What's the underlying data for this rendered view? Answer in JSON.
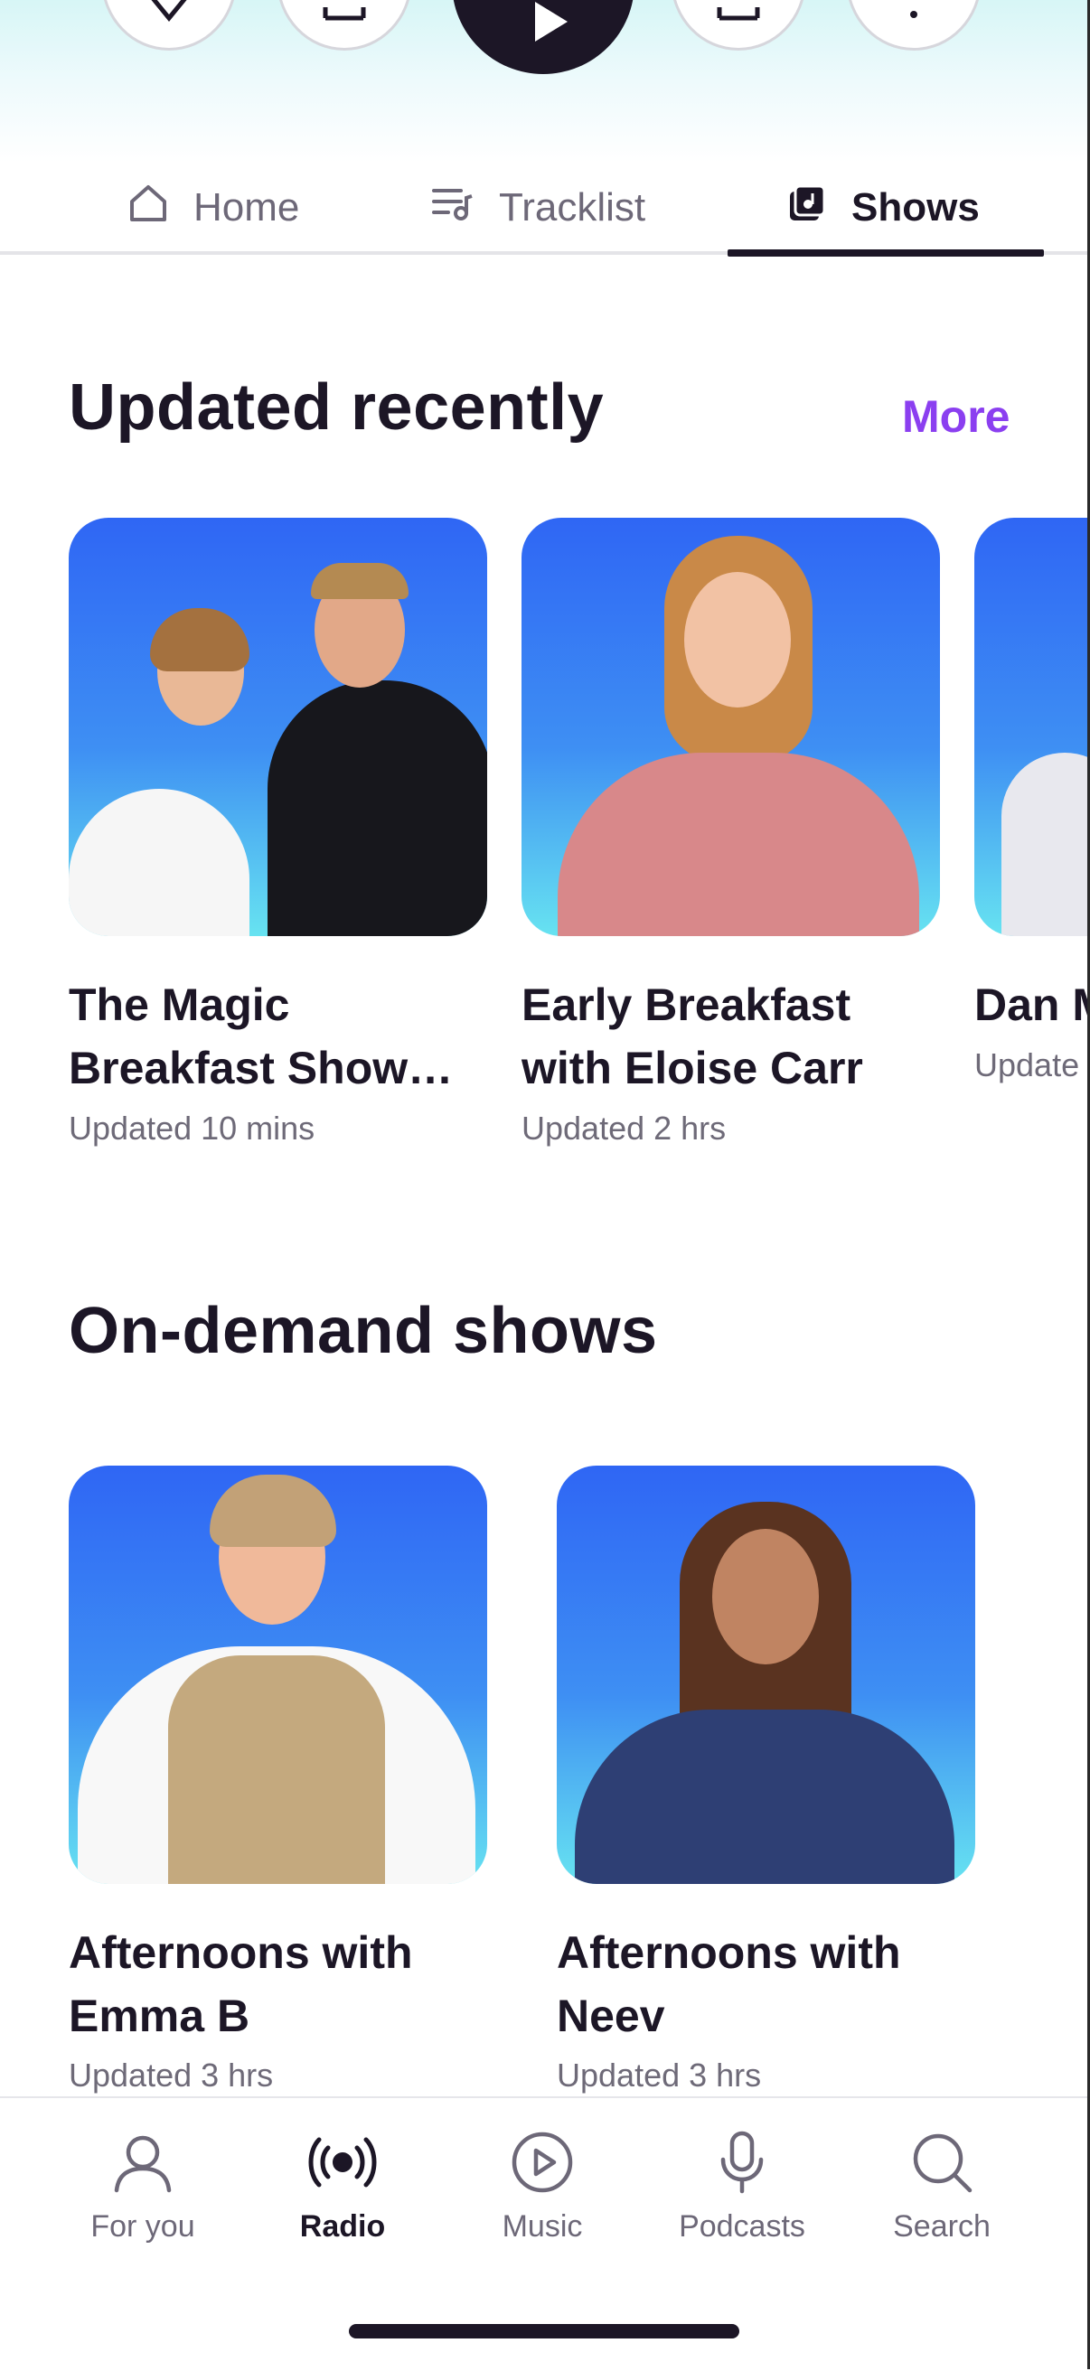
{
  "tabs": [
    {
      "label": "Home",
      "icon": "home-icon"
    },
    {
      "label": "Tracklist",
      "icon": "tracklist-icon"
    },
    {
      "label": "Shows",
      "icon": "shows-icon",
      "active": true
    }
  ],
  "updated_recently": {
    "title": "Updated recently",
    "more_label": "More",
    "cards": [
      {
        "title": "The Magic Breakfast Show…",
        "subtitle": "Updated 10 mins"
      },
      {
        "title": "Early Breakfast with Eloise Carr",
        "subtitle": "Updated 2 hrs"
      },
      {
        "title": "Dan M",
        "subtitle": "Update"
      }
    ]
  },
  "on_demand": {
    "title": "On-demand shows",
    "cards": [
      {
        "title": "Afternoons with Emma B",
        "subtitle": "Updated 3 hrs"
      },
      {
        "title": "Afternoons with Neev",
        "subtitle": "Updated 3 hrs"
      }
    ]
  },
  "bottom_nav": [
    {
      "label": "For you",
      "icon": "person-icon"
    },
    {
      "label": "Radio",
      "icon": "radio-broadcast-icon",
      "active": true
    },
    {
      "label": "Music",
      "icon": "play-circle-icon"
    },
    {
      "label": "Podcasts",
      "icon": "microphone-icon"
    },
    {
      "label": "Search",
      "icon": "search-icon"
    }
  ],
  "colors": {
    "accent": "#8b3ff0",
    "dark": "#1c1626",
    "muted": "#6e6a78",
    "card_gradient_top": "#2f66f4",
    "card_gradient_bottom": "#67e3f1"
  }
}
